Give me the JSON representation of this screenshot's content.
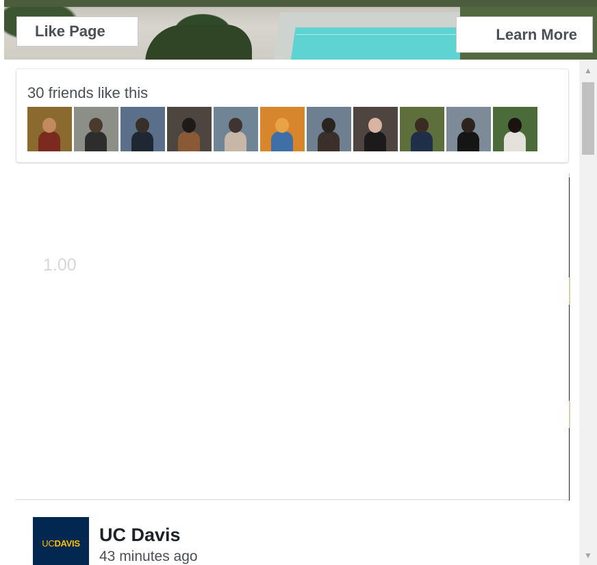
{
  "cover": {
    "like_button_label": "Like Page",
    "learn_more_label": "Learn More"
  },
  "friends": {
    "summary": "30 friends like this",
    "avatars": [
      {
        "name": "friend-avatar-1",
        "bg": "#8a6a2e",
        "head": "#c28a5e",
        "body": "#7a2a1f"
      },
      {
        "name": "friend-avatar-2",
        "bg": "#8c8f88",
        "head": "#4a3a2e",
        "body": "#2d2d2d"
      },
      {
        "name": "friend-avatar-3",
        "bg": "#5a6f8a",
        "head": "#3a2e28",
        "body": "#1f2733"
      },
      {
        "name": "friend-avatar-4",
        "bg": "#4d4540",
        "head": "#1e1a18",
        "body": "#8a5a36"
      },
      {
        "name": "friend-avatar-5",
        "bg": "#6f8494",
        "head": "#3f3431",
        "body": "#c8b7a6"
      },
      {
        "name": "friend-avatar-6",
        "bg": "#d7862c",
        "head": "#e8a345",
        "body": "#3f6fa6"
      },
      {
        "name": "friend-avatar-7",
        "bg": "#6e7f91",
        "head": "#2a2420",
        "body": "#3b2f2a"
      },
      {
        "name": "friend-avatar-8",
        "bg": "#4f4540",
        "head": "#d9b4a0",
        "body": "#1c1a1a"
      },
      {
        "name": "friend-avatar-9",
        "bg": "#5d6f3a",
        "head": "#3a2c22",
        "body": "#1f2f4a"
      },
      {
        "name": "friend-avatar-10",
        "bg": "#7d8a98",
        "head": "#2d241f",
        "body": "#151515"
      },
      {
        "name": "friend-avatar-11",
        "bg": "#4c6b3a",
        "head": "#1a1411",
        "body": "#e4e0da"
      }
    ]
  },
  "embed": {
    "gauge_value": "1.00"
  },
  "post": {
    "avatar_uc": "UC",
    "avatar_davis": "DAVIS",
    "page_name": "UC Davis",
    "timestamp": "43 minutes ago"
  },
  "colors": {
    "brand_navy": "#022851",
    "brand_gold": "#ffbf00",
    "button_text": "#4b4f56"
  }
}
